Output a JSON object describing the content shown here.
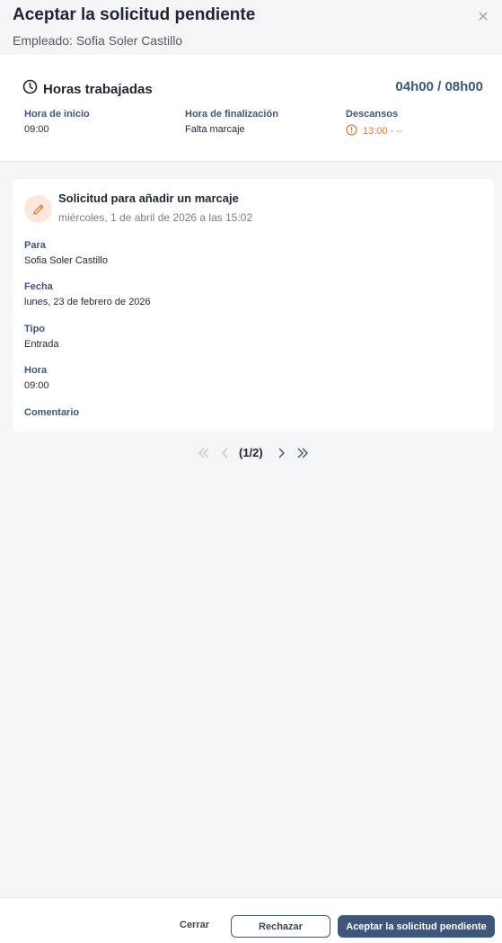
{
  "dialog": {
    "title": "Aceptar la solicitud pendiente",
    "subtitle": "Empleado: Sofia Soler Castillo",
    "close_icon": "close-icon"
  },
  "hours": {
    "title": "Horas trabajadas",
    "total": "04h00 / 08h00",
    "columns": [
      {
        "label": "Hora de inicio",
        "value": "09:00"
      },
      {
        "label": "Hora de finalización",
        "value": "Falta marcaje"
      },
      {
        "label": "Descansos",
        "value": "13:00 - --"
      }
    ],
    "icon": "clock-icon",
    "break_icon": "alert-circle-icon",
    "break_color": "#e07b3c"
  },
  "request": {
    "icon": "pencil-icon",
    "title": "Solicitud para añadir un marcaje",
    "date": "miércoles, 1 de abril de 2026 a las 15:02",
    "fields": [
      {
        "label": "Para",
        "value": "Sofia Soler Castillo"
      },
      {
        "label": "Fecha",
        "value": "lunes, 23 de febrero de 2026"
      },
      {
        "label": "Tipo",
        "value": "Entrada"
      },
      {
        "label": "Hora",
        "value": "09:00"
      },
      {
        "label": "Comentario",
        "value": ""
      }
    ]
  },
  "pagination": {
    "text": "(1/2)",
    "icons": [
      "double-chevron-left-icon",
      "chevron-left-icon",
      "chevron-right-icon",
      "double-chevron-right-icon"
    ]
  },
  "footer": {
    "close_label": "Cerrar",
    "reject_label": "Rechazar",
    "accept_label": "Aceptar la solicitud pendiente"
  },
  "colors": {
    "accent": "#3f5579",
    "background": "#f3f5f6",
    "warning": "#e07b3c"
  }
}
